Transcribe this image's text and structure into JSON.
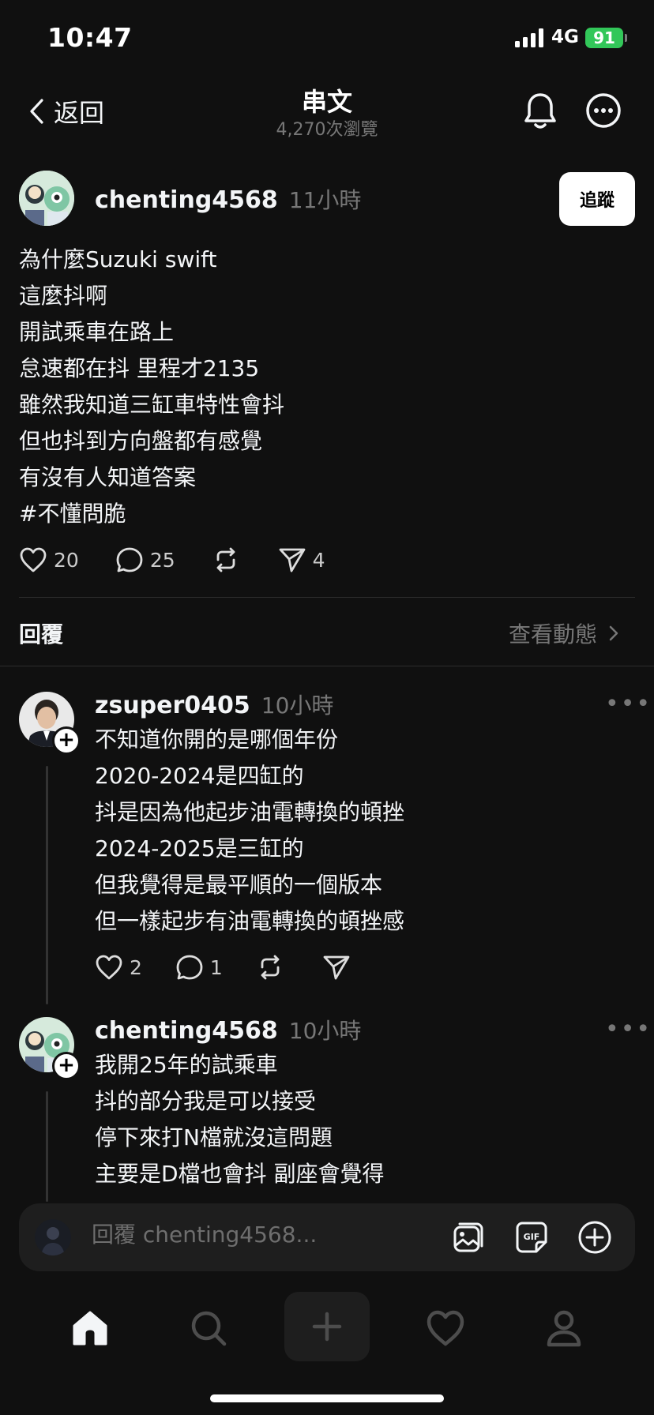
{
  "status": {
    "time": "10:47",
    "network": "4G",
    "battery": "91"
  },
  "header": {
    "back_label": "返回",
    "title": "串文",
    "views": "4,270次瀏覽"
  },
  "post": {
    "username": "chenting4568",
    "time": "11小時",
    "follow_label": "追蹤",
    "lines": [
      "為什麼Suzuki swift",
      "這麼抖啊",
      "開試乘車在路上",
      "怠速都在抖 里程才2135",
      "雖然我知道三缸車特性會抖",
      "但也抖到方向盤都有感覺",
      "有沒有人知道答案",
      "#不懂問脆"
    ],
    "likes": "20",
    "comments": "25",
    "shares": "4"
  },
  "replies_header": {
    "label": "回覆",
    "activity_label": "查看動態"
  },
  "replies": [
    {
      "username": "zsuper0405",
      "time": "10小時",
      "lines": [
        "不知道你開的是哪個年份",
        "2020-2024是四缸的",
        "抖是因為他起步油電轉換的頓挫",
        "2024-2025是三缸的",
        "但我覺得是最平順的一個版本",
        "但一樣起步有油電轉換的頓挫感"
      ],
      "likes": "2",
      "comments": "1"
    },
    {
      "username": "chenting4568",
      "time": "10小時",
      "lines": [
        "我開25年的試乘車",
        "抖的部分我是可以接受",
        "停下來打N檔就沒這問題",
        "主要是D檔也會抖 副座會覺得"
      ]
    }
  ],
  "composer": {
    "placeholder": "回覆 chenting4568..."
  },
  "colors": {
    "background": "#101010",
    "text": "#f3f5f7",
    "muted": "#777777",
    "battery": "#32c759"
  }
}
